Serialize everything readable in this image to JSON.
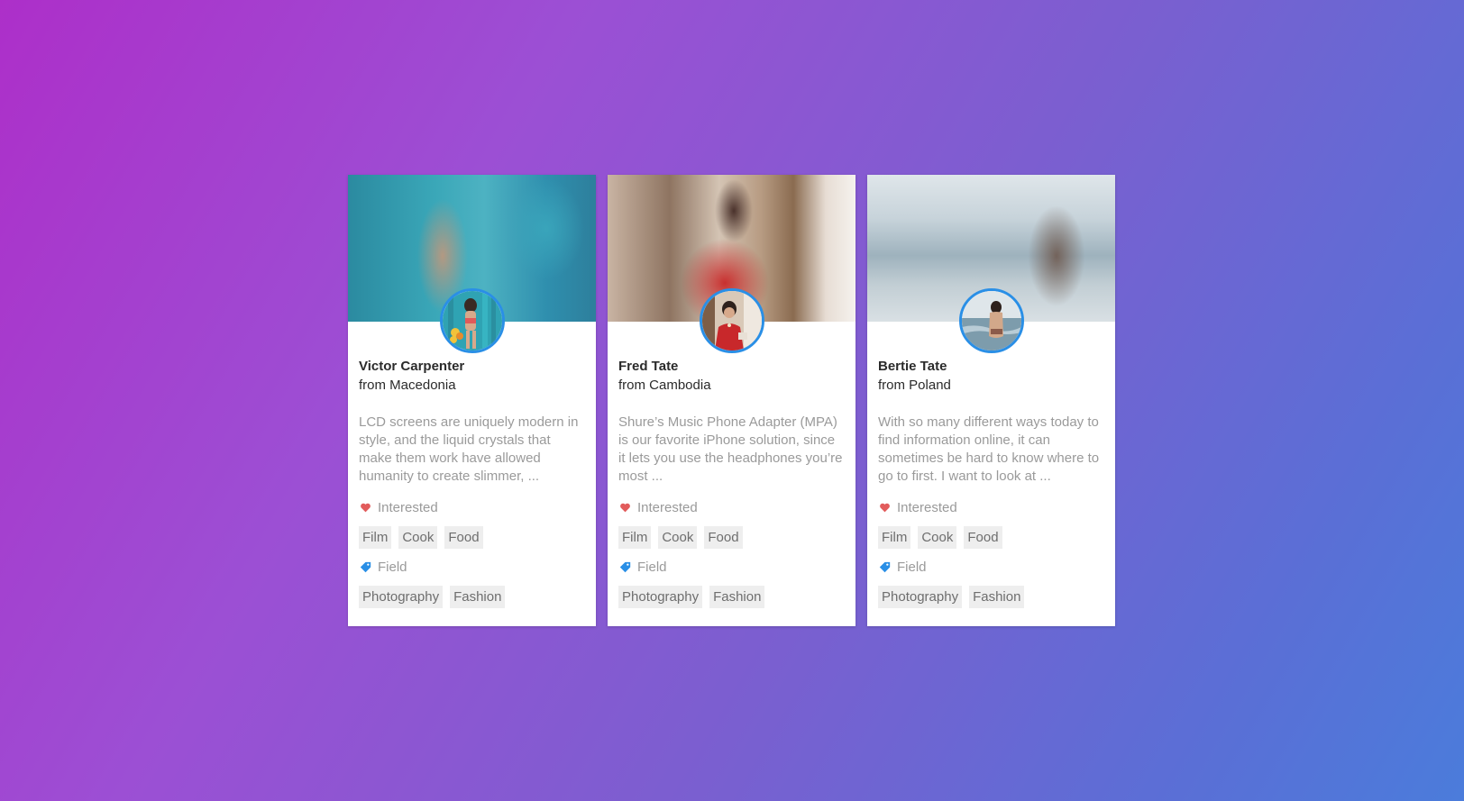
{
  "cards": [
    {
      "name": "Victor Carpenter",
      "origin": "from Macedonia",
      "description": "LCD screens are uniquely modern in style, and the liquid crystals that make them work have allowed humanity to create slimmer, ...",
      "interested_label": "Interested",
      "interests": [
        "Film",
        "Cook",
        "Food"
      ],
      "field_label": "Field",
      "fields": [
        "Photography",
        "Fashion"
      ]
    },
    {
      "name": "Fred Tate",
      "origin": "from Cambodia",
      "description": "Shure’s Music Phone Adapter (MPA) is our favorite iPhone solution, since it lets you use the headphones you’re most ...",
      "interested_label": "Interested",
      "interests": [
        "Film",
        "Cook",
        "Food"
      ],
      "field_label": "Field",
      "fields": [
        "Photography",
        "Fashion"
      ]
    },
    {
      "name": "Bertie Tate",
      "origin": "from Poland",
      "description": "With so many different ways today to find information online, it can sometimes be hard to know where to go to first. I want to look at ...",
      "interested_label": "Interested",
      "interests": [
        "Film",
        "Cook",
        "Food"
      ],
      "field_label": "Field",
      "fields": [
        "Photography",
        "Fashion"
      ]
    }
  ],
  "icons": {
    "interested": "heart-icon",
    "field": "tag-icon"
  },
  "colors": {
    "heart": "#e25c5c",
    "tag": "#2a8fe6",
    "avatar_border": "#2a8fe6",
    "tag_bg": "#eeeeee",
    "description_text": "#9a9a9a"
  }
}
